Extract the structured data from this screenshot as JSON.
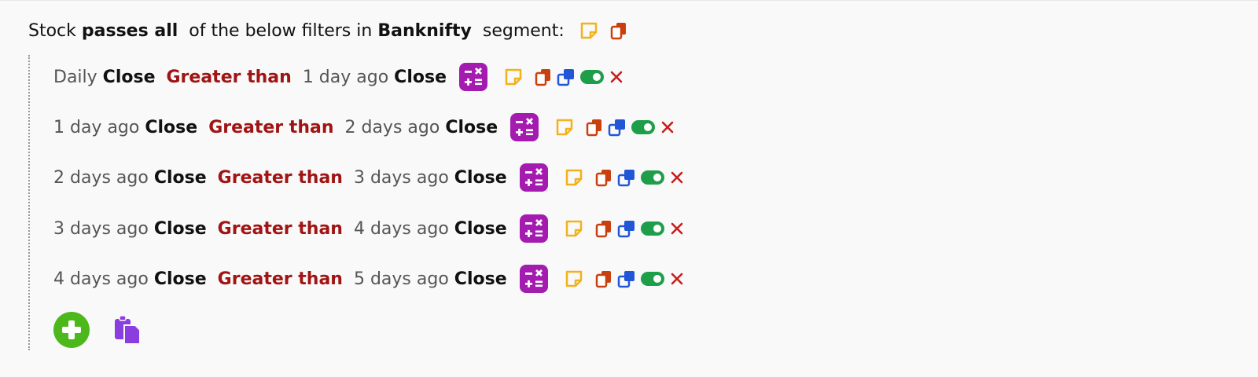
{
  "header": {
    "prefix": "Stock",
    "mode": "passes all",
    "middle": "of the below filters in",
    "segment": "Banknifty",
    "suffix": "segment:"
  },
  "filters": [
    {
      "lhs_timeframe": "Daily",
      "lhs_field": "Close",
      "operator": "Greater than",
      "rhs_timeframe": "1 day ago",
      "rhs_field": "Close"
    },
    {
      "lhs_timeframe": "1 day ago",
      "lhs_field": "Close",
      "operator": "Greater than",
      "rhs_timeframe": "2 days ago",
      "rhs_field": "Close"
    },
    {
      "lhs_timeframe": "2 days ago",
      "lhs_field": "Close",
      "operator": "Greater than",
      "rhs_timeframe": "3 days ago",
      "rhs_field": "Close"
    },
    {
      "lhs_timeframe": "3 days ago",
      "lhs_field": "Close",
      "operator": "Greater than",
      "rhs_timeframe": "4 days ago",
      "rhs_field": "Close"
    },
    {
      "lhs_timeframe": "4 days ago",
      "lhs_field": "Close",
      "operator": "Greater than",
      "rhs_timeframe": "5 days ago",
      "rhs_field": "Close"
    }
  ],
  "row_icons": [
    "calculator-icon",
    "sticky-note-icon",
    "copy-icon",
    "duplicate-icon",
    "toggle-on-icon",
    "delete-x-icon"
  ],
  "actions": [
    "add-filter-icon",
    "paste-icon"
  ],
  "colors": {
    "operator": "#a01414",
    "calculator": "#a41bb0",
    "note": "#f2b21b",
    "copy": "#c9400f",
    "duplicate": "#2156d6",
    "toggle": "#1f9e4a",
    "delete": "#c81e1e",
    "add": "#4cb81c",
    "paste": "#8a3ee0"
  }
}
